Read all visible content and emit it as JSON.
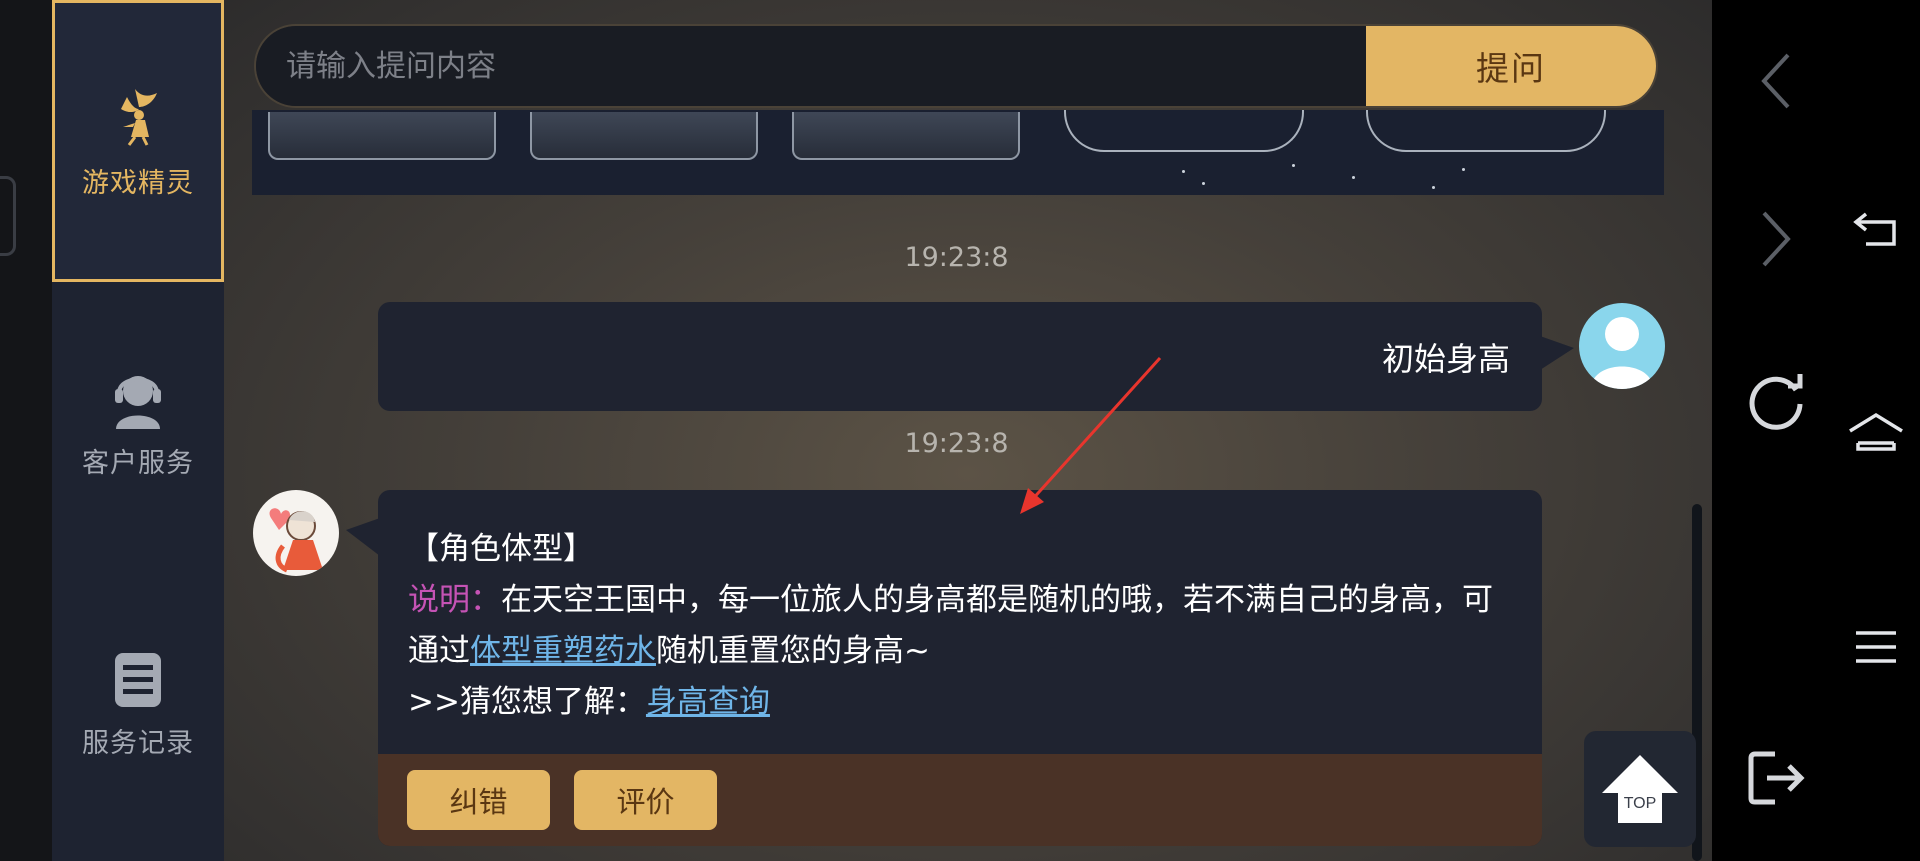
{
  "sidebar": {
    "items": [
      {
        "label": "游戏精灵",
        "icon": "fairy-icon",
        "active": true
      },
      {
        "label": "客户服务",
        "icon": "headset-icon",
        "active": false
      },
      {
        "label": "服务记录",
        "icon": "record-list-icon",
        "active": false
      }
    ]
  },
  "search": {
    "placeholder": "请输入提问内容",
    "button_label": "提问"
  },
  "chat": {
    "messages": [
      {
        "timestamp": "19:23:8",
        "sender": "user",
        "text": "初始身高"
      },
      {
        "timestamp": "19:23:8",
        "sender": "bot",
        "title": "【角色体型】",
        "desc_label": "说明：",
        "desc_text_1": "在天空王国中，每一位旅人的身高都是随机的哦，若不满自己的身高，可通过",
        "link_1": "体型重塑药水",
        "desc_text_2": "随机重置您的身高~",
        "guess_prefix": ">>猜您想了解：",
        "link_2": "身高查询",
        "actions": {
          "correct": "纠错",
          "rate": "评价"
        }
      }
    ]
  },
  "top_button": {
    "label": "TOP"
  },
  "colors": {
    "accent_gold": "#e3b664",
    "link_blue": "#6fb5e8",
    "label_magenta": "#c553b5",
    "panel_dark": "#1f2330"
  }
}
